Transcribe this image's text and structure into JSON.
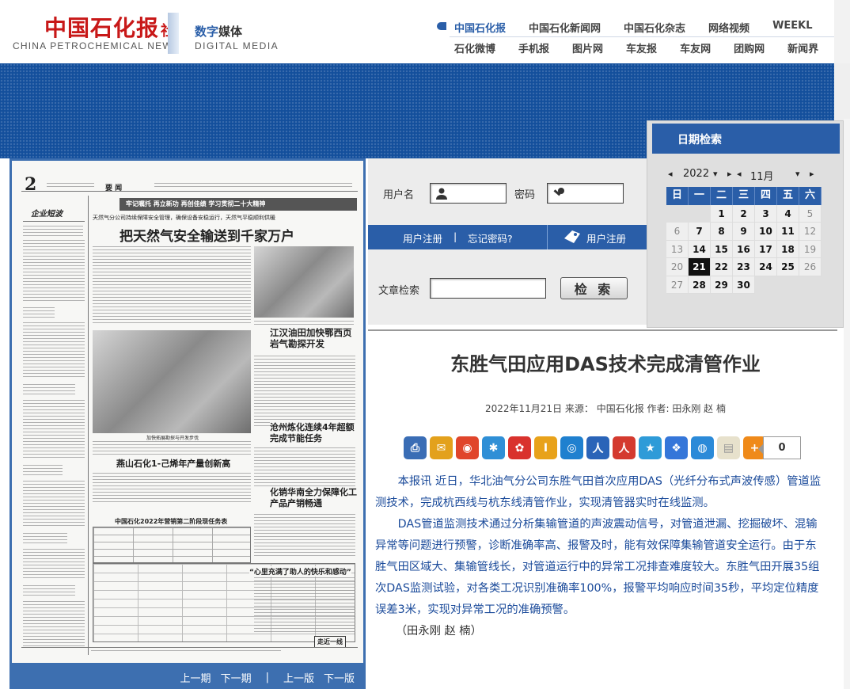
{
  "header": {
    "logo_cn": "中国石化报",
    "logo_she": "社",
    "logo_en": "CHINA PETROCHEMICAL NEWS",
    "digital_cn_a": "数字",
    "digital_cn_b": "媒体",
    "digital_en": "DIGITAL MEDIA",
    "nav_row1": [
      "中国石化报",
      "中国石化新闻网",
      "中国石化杂志",
      "网络视频",
      "WEEKL"
    ],
    "nav_row2": [
      "石化微博",
      "手机报",
      "图片网",
      "车友报",
      "车友网",
      "团购网",
      "新闻界"
    ]
  },
  "login": {
    "username_label": "用户名",
    "password_label": "密码",
    "register_link": "用户注册",
    "separator": "|",
    "forgot_link": "忘记密码?",
    "register_button": "用户注册",
    "article_search_label": "文章检索",
    "search_button": "检 索"
  },
  "calendar": {
    "title": "日期检索",
    "prev_year": "◂",
    "year": "2022",
    "year_dropdown": "▾",
    "next_year": "▸",
    "prev_month": "◂",
    "month": "11月",
    "month_dropdown": "▾",
    "next_month": "▸",
    "weekdays": [
      "日",
      "一",
      "二",
      "三",
      "四",
      "五",
      "六"
    ],
    "days": [
      "",
      "",
      "1",
      "2",
      "3",
      "4",
      "5",
      "6",
      "7",
      "8",
      "9",
      "10",
      "11",
      "12",
      "13",
      "14",
      "15",
      "16",
      "17",
      "18",
      "19",
      "20",
      "21",
      "22",
      "23",
      "24",
      "25",
      "26",
      "27",
      "28",
      "29",
      "30",
      "",
      "",
      ""
    ],
    "selected_day": "21"
  },
  "paper": {
    "page_number": "2",
    "page_label": "要 闻",
    "section_label": "企业短波",
    "slogan": "牢记嘱托 再立新功 再创佳绩 学习贯彻二十大精神",
    "kicker": "天然气分公司持续保障安全管理，确保设备安稳运行，天然气平稳顺利供暖",
    "headline": "把天然气安全输送到千家万户",
    "sub_headline_1": "江汉油田加快鄂西页岩气勘探开发",
    "sub_headline_2": "沧州炼化连续4年超额完成节能任务",
    "sub_headline_3": "燕山石化1-己烯年产量创新高",
    "sub_headline_4": "化销华南全力保障化工产品产销畅通",
    "table_title": "中国石化2022年营销第二阶段现任务表",
    "quote_title": "“心里充满了助人的快乐和感动”",
    "corner_tag": "走近一线",
    "photo_caption": "加快拓展勘探与开发步伐"
  },
  "paper_nav": {
    "prev_issue": "上一期",
    "next_issue": "下一期",
    "separator": "|",
    "prev_page": "上一版",
    "next_page": "下一版"
  },
  "article": {
    "title": "东胜气田应用DAS技术完成清管作业",
    "meta": "2022年11月21日 来源： 中国石化报 作者: 田永刚 赵 楠",
    "share_count": "0",
    "paragraphs": [
      "本报讯 近日，华北油气分公司东胜气田首次应用DAS（光纤分布式声波传感）管道监测技术，完成杭西线与杭东线清管作业，实现清管器实时在线监测。",
      "DAS管道监测技术通过分析集输管道的声波震动信号，对管道泄漏、挖掘破坏、混输异常等问题进行预警，诊断准确率高、报警及时，能有效保障集输管道安全运行。由于东胜气田区域大、集输管线长，对管道运行中的异常工况排查难度较大。东胜气田开展35组次DAS监测试验，对各类工况识别准确率100%，报警平均响应时间35秒，平均定位精度误差3米，实现对异常工况的准确预警。"
    ],
    "author_line": "（田永刚 赵 楠）"
  },
  "share_icons": [
    {
      "name": "print-icon",
      "color": "#3a6db5",
      "glyph": "⎙"
    },
    {
      "name": "email-icon",
      "color": "#e3a11c",
      "glyph": "✉"
    },
    {
      "name": "weibo-icon",
      "color": "#e0452b",
      "glyph": "◉"
    },
    {
      "name": "qzone-icon",
      "color": "#2f8fd6",
      "glyph": "✱"
    },
    {
      "name": "renren-icon",
      "color": "#d9322d",
      "glyph": "✿"
    },
    {
      "name": "tianya-icon",
      "color": "#e8a21a",
      "glyph": "I"
    },
    {
      "name": "sohu-icon",
      "color": "#1f80cf",
      "glyph": "◎"
    },
    {
      "name": "people-icon",
      "color": "#2a64b8",
      "glyph": "人"
    },
    {
      "name": "people-red-icon",
      "color": "#d43a2f",
      "glyph": "人"
    },
    {
      "name": "star-icon",
      "color": "#2e9bd8",
      "glyph": "★"
    },
    {
      "name": "baidu-icon",
      "color": "#3576d9",
      "glyph": "❖"
    },
    {
      "name": "globe-icon",
      "color": "#2b8ad8",
      "glyph": "◍"
    },
    {
      "name": "note-icon",
      "color": "#e7e1cc",
      "glyph": "▤"
    },
    {
      "name": "plus-icon",
      "color": "#ef8a1a",
      "glyph": "+"
    }
  ]
}
